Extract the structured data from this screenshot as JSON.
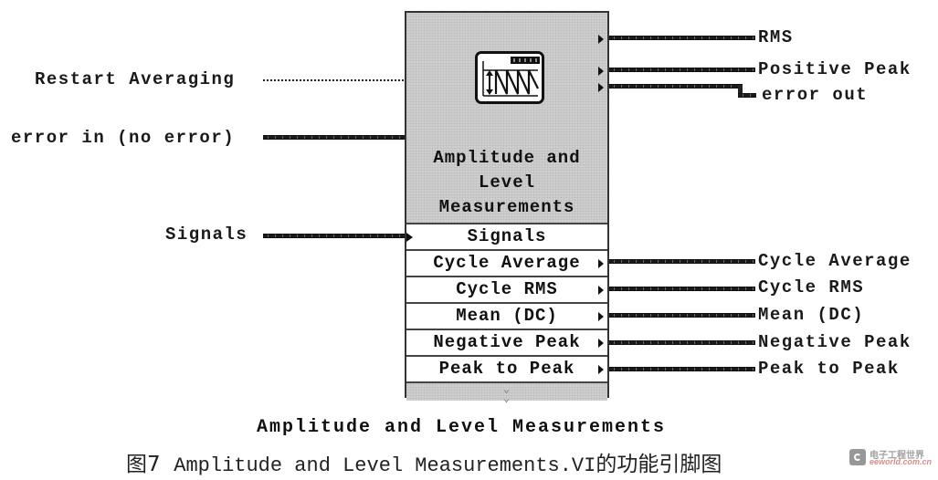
{
  "vi": {
    "title_lines": [
      "Amplitude and",
      "Level",
      "Measurements"
    ],
    "icon": "amplitude-level-measurement-icon"
  },
  "inputs": [
    {
      "label": "Restart Averaging",
      "wire": "boolean-dotted"
    },
    {
      "label": "error in (no error)",
      "wire": "cluster"
    },
    {
      "label": "Signals",
      "wire": "cluster"
    }
  ],
  "outputs_top": [
    {
      "label": "RMS"
    },
    {
      "label": "Positive Peak"
    },
    {
      "label": "error out"
    }
  ],
  "node_rows": [
    {
      "label": "Signals",
      "direction": "input"
    },
    {
      "label": "Cycle Average",
      "direction": "output"
    },
    {
      "label": "Cycle RMS",
      "direction": "output"
    },
    {
      "label": "Mean (DC)",
      "direction": "output"
    },
    {
      "label": "Negative Peak",
      "direction": "output"
    },
    {
      "label": "Peak to Peak",
      "direction": "output"
    }
  ],
  "outputs_rows": [
    {
      "label": "Cycle Average"
    },
    {
      "label": "Cycle RMS"
    },
    {
      "label": "Mean (DC)"
    },
    {
      "label": "Negative Peak"
    },
    {
      "label": "Peak to Peak"
    }
  ],
  "caption": {
    "english": "Amplitude and Level Measurements",
    "figure_prefix": "图7",
    "figure_en": "Amplitude and Level Measurements.VI",
    "figure_suffix": "的功能引脚图"
  },
  "watermark": {
    "cn": "电子工程世界",
    "en": "eeworld.com.cn"
  }
}
